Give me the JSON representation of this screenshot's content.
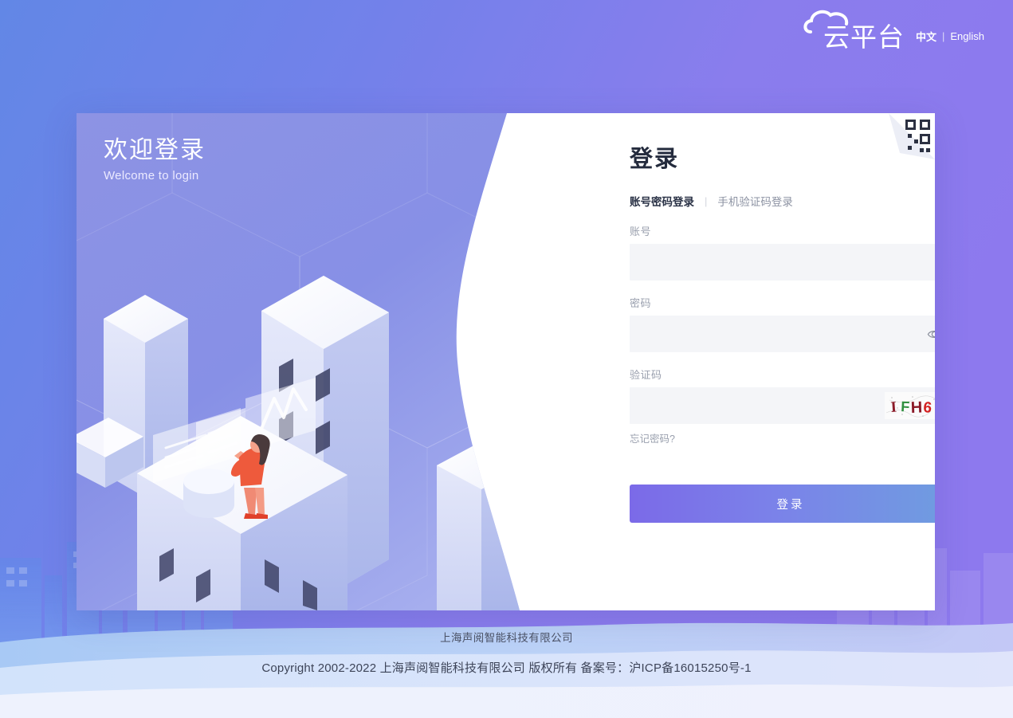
{
  "header": {
    "brand_name": "云平台",
    "brand_icon": "cloud-icon",
    "lang_zh": "中文",
    "lang_separator": "|",
    "lang_en": "English"
  },
  "card": {
    "welcome_cn": "欢迎登录",
    "welcome_en": "Welcome to login",
    "qr_icon": "qr-code-icon"
  },
  "form": {
    "title": "登录",
    "tabs": [
      {
        "label": "账号密码登录",
        "active": true
      },
      {
        "label": "手机验证码登录",
        "active": false
      }
    ],
    "tab_separator": "|",
    "account": {
      "label": "账号",
      "value": "",
      "placeholder": ""
    },
    "password": {
      "label": "密码",
      "value": "",
      "placeholder": "",
      "toggle_icon": "eye-icon"
    },
    "captcha": {
      "label": "验证码",
      "value": "",
      "placeholder": "",
      "image_text": "IFH6",
      "image_chars": [
        {
          "char": "I",
          "color": "#8b1a28"
        },
        {
          "char": "F",
          "color": "#2f8f3f"
        },
        {
          "char": "H",
          "color": "#8b1a28"
        },
        {
          "char": "6",
          "color": "#d32020"
        }
      ]
    },
    "forgot_password": "忘记密码?",
    "submit_label": "登录"
  },
  "footer": {
    "company": "上海声阅智能科技有限公司",
    "copyright": "Copyright 2002-2022 上海声阅智能科技有限公司 版权所有 备案号：沪ICP备16015250号-1"
  },
  "colors": {
    "bg_left": "#6287e6",
    "bg_right": "#8d79ee",
    "button_from": "#7b6ae8",
    "button_to": "#6f9de0",
    "input_fill": "#f4f5f8",
    "title_text": "#242b3d",
    "label_text": "#9aa0ae"
  }
}
